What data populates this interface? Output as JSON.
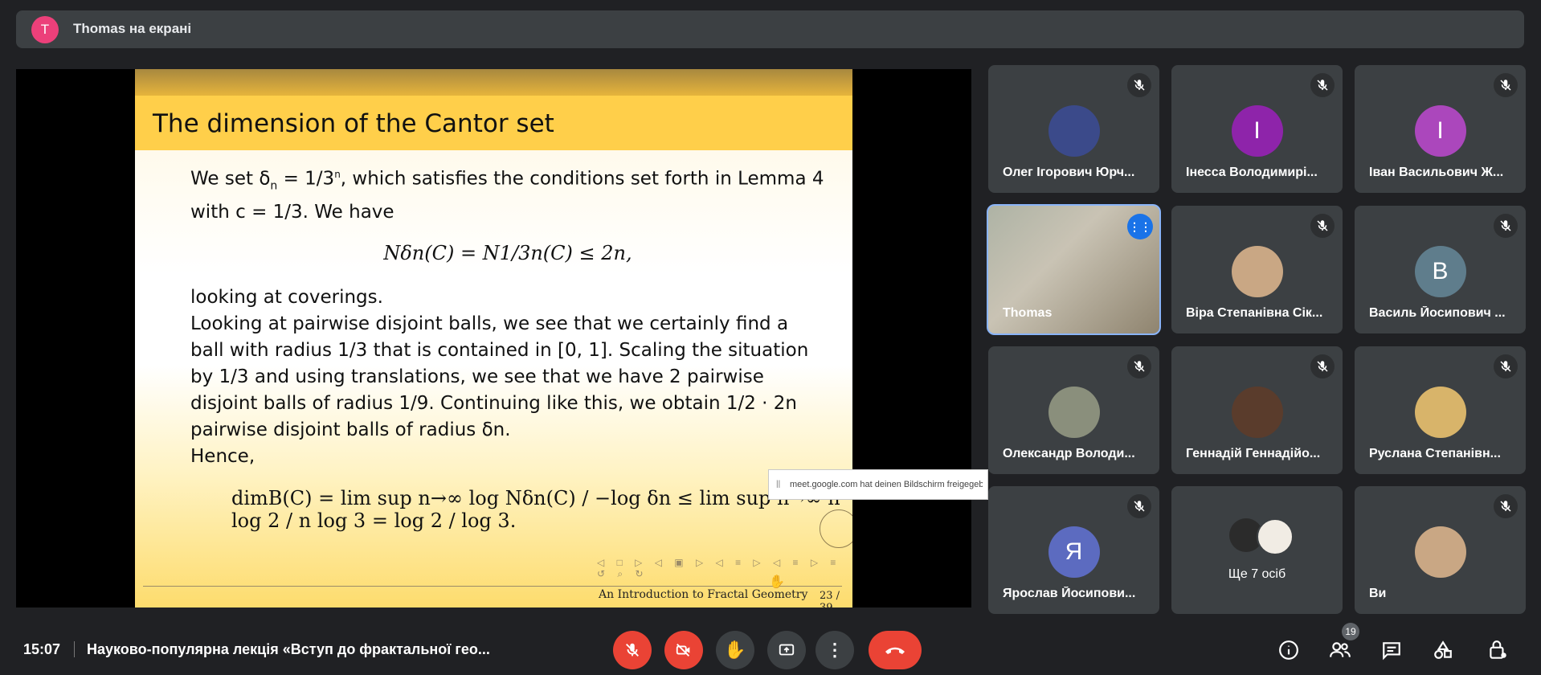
{
  "presenter_bar": {
    "avatar_letter": "T",
    "text": "Thomas на екрані"
  },
  "slide": {
    "title": "The dimension of the Cantor set",
    "para1_a": "We set δ",
    "para1_b": "n",
    "para1_c": " = 1/3",
    "para1_d": "n",
    "para1_e": ", which satisfies the conditions set forth in Lemma 4",
    "para1_f": "with c = 1/3. We have",
    "eq1": "Nδn(C) = N1/3n(C) ≤ 2n,",
    "line_cov": "looking at coverings.",
    "para2": "Looking at pairwise disjoint balls, we see that we certainly find a ball with radius 1/3 that is contained in [0, 1]. Scaling the situation by 1/3 and using translations, we see that we have 2 pairwise disjoint balls of radius 1/9. Continuing like this, we obtain 1/2 · 2n pairwise disjoint balls of radius δn.",
    "hence": "Hence,",
    "eq2": "dimB(C) = lim sup n→∞ log Nδn(C) / −log δn ≤ lim sup n→∞ n log 2 / n log 3 = log 2 / log 3.",
    "footer_title": "An Introduction to Fractal Geometry",
    "page": "23 / 39"
  },
  "toast": {
    "text": "meet.google.com hat deinen Bildschirm freigegeben"
  },
  "participants": [
    {
      "name": "Олег Ігорович Юрч...",
      "type": "photo",
      "color": "#3b4a8a"
    },
    {
      "name": "Інесса Володимирі...",
      "type": "letter",
      "letter": "І",
      "color": "#8e24aa"
    },
    {
      "name": "Іван Васильович Ж...",
      "type": "letter",
      "letter": "І",
      "color": "#ab47bc"
    },
    {
      "name": "Thomas",
      "type": "video"
    },
    {
      "name": "Віра Степанівна Сік...",
      "type": "photo",
      "color": "#c9a784"
    },
    {
      "name": "Василь Йосипович ...",
      "type": "letter",
      "letter": "В",
      "color": "#5f7d8c"
    },
    {
      "name": "Олександр Володи...",
      "type": "photo",
      "color": "#8a8f7c"
    },
    {
      "name": "Геннадій Геннадійо...",
      "type": "photo",
      "color": "#5a3c2c"
    },
    {
      "name": "Руслана Степанівн...",
      "type": "photo",
      "color": "#d8b46a"
    },
    {
      "name": "Ярослав Йосипови...",
      "type": "letter",
      "letter": "Я",
      "color": "#5c6bc0"
    },
    {
      "name": "Ще 7 осіб",
      "type": "more"
    },
    {
      "name": "Ви",
      "type": "photo",
      "color": "#c9a784"
    }
  ],
  "bottom": {
    "time": "15:07",
    "meeting_title": "Науково-популярна лекція «Вступ до фрактальної гео...",
    "people_count": "19"
  }
}
